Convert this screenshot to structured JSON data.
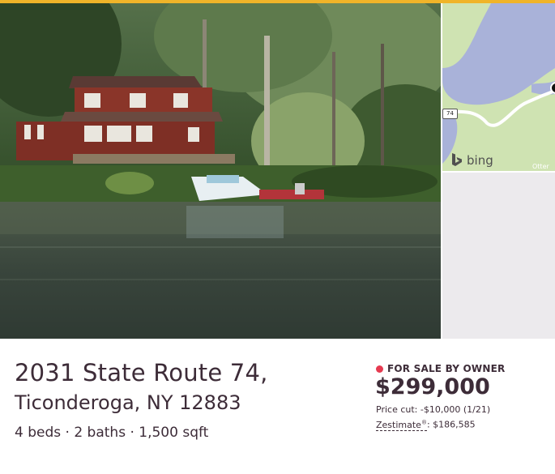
{
  "listing": {
    "address_line1": "2031 State Route 74,",
    "address_line2": "Ticonderoga, NY 12883",
    "facts": "4 beds · 2 baths · 1,500 sqft",
    "status": "FOR SALE BY OWNER",
    "price": "$299,000",
    "price_cut": "Price cut: -$10,000 (1/21)",
    "zestimate_label": "Zestimate",
    "zestimate_mark": "®",
    "zestimate_value": ": $186,585"
  },
  "map": {
    "route_number": "74",
    "provider": "bing",
    "place_label": "Otter"
  },
  "colors": {
    "status_dot": "#e63a50",
    "text_primary": "#3d2c38",
    "top_strip": "#f0b429",
    "map_water": "#a9b2d9",
    "map_land": "#cfe3b2"
  }
}
